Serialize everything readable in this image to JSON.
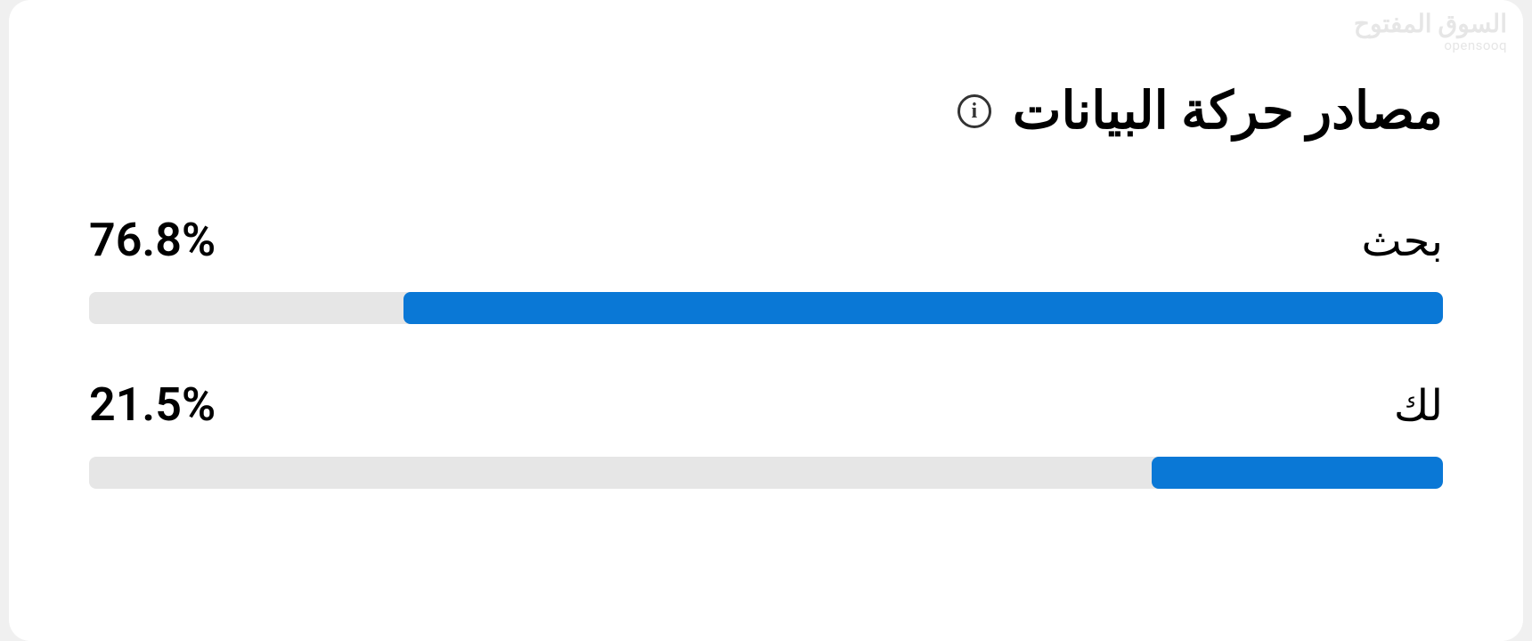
{
  "title": "مصادر حركة البيانات",
  "info_glyph": "i",
  "rows": [
    {
      "label": "بحث",
      "percent_text": "76.8%",
      "percent_value": 76.8
    },
    {
      "label": "لك",
      "percent_text": "21.5%",
      "percent_value": 21.5
    }
  ],
  "watermark": {
    "ar": "السوق المفتوح",
    "en": "opensooq"
  },
  "colors": {
    "bar_fill": "#0a78d6",
    "bar_track": "#e6e6e6"
  },
  "chart_data": {
    "type": "bar",
    "title": "مصادر حركة البيانات",
    "categories": [
      "بحث",
      "لك"
    ],
    "values": [
      76.8,
      21.5
    ],
    "xlabel": "",
    "ylabel": "%",
    "ylim": [
      0,
      100
    ]
  }
}
